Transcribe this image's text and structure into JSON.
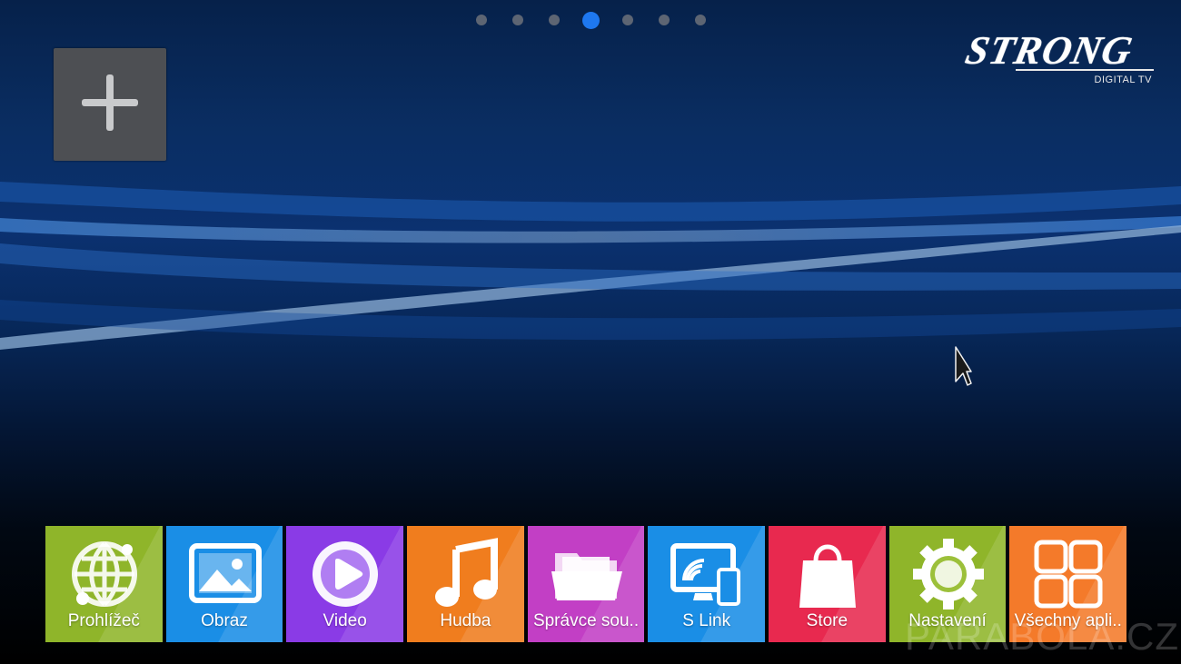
{
  "home": {
    "page_indicator": {
      "count": 7,
      "active_index": 3
    },
    "add_widget": {
      "icon": "plus-icon"
    },
    "logo": {
      "brand": "STRONG",
      "tagline": "DIGITAL TV"
    },
    "cursor": {
      "icon": "mouse-pointer-icon"
    }
  },
  "dock": {
    "apps": [
      {
        "label": "Prohlížeč",
        "color": "#8fb52a",
        "icon": "globe-icon"
      },
      {
        "label": "Obraz",
        "color": "#1a8ee6",
        "icon": "image-icon"
      },
      {
        "label": "Video",
        "color": "#8a3be6",
        "icon": "play-icon"
      },
      {
        "label": "Hudba",
        "color": "#f07d1e",
        "icon": "music-note-icon"
      },
      {
        "label": "Správce sou..",
        "color": "#c23fc5",
        "icon": "folder-icon"
      },
      {
        "label": "S Link",
        "color": "#1a8ee6",
        "icon": "screen-cast-icon"
      },
      {
        "label": "Store",
        "color": "#e8294f",
        "icon": "shopping-bag-icon"
      },
      {
        "label": "Nastavení",
        "color": "#8fb52a",
        "icon": "gear-icon"
      },
      {
        "label": "Všechny apli..",
        "color": "#f47a2a",
        "icon": "app-grid-icon"
      }
    ]
  },
  "watermark": "PARABOLA.CZ"
}
